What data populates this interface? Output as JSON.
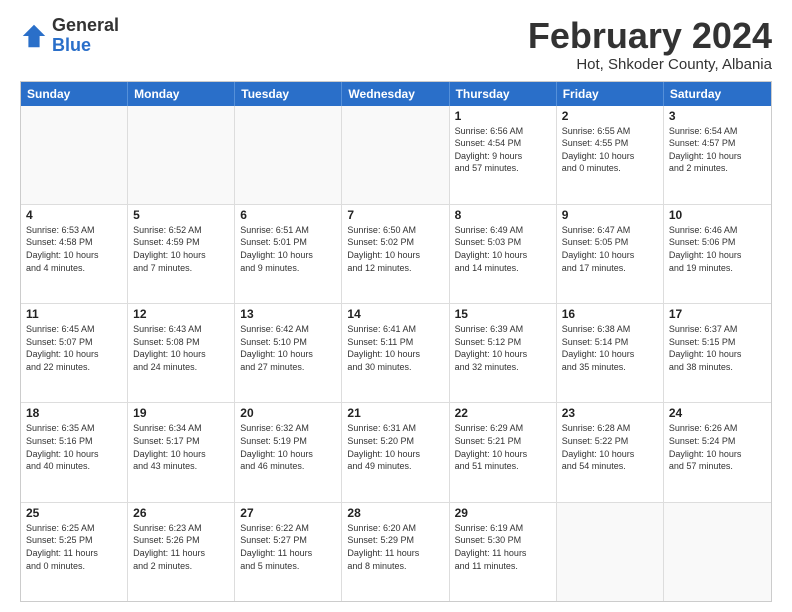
{
  "logo": {
    "general": "General",
    "blue": "Blue"
  },
  "title": {
    "main": "February 2024",
    "sub": "Hot, Shkoder County, Albania"
  },
  "calendar": {
    "headers": [
      "Sunday",
      "Monday",
      "Tuesday",
      "Wednesday",
      "Thursday",
      "Friday",
      "Saturday"
    ],
    "rows": [
      [
        {
          "day": "",
          "info": "",
          "empty": true
        },
        {
          "day": "",
          "info": "",
          "empty": true
        },
        {
          "day": "",
          "info": "",
          "empty": true
        },
        {
          "day": "",
          "info": "",
          "empty": true
        },
        {
          "day": "1",
          "info": "Sunrise: 6:56 AM\nSunset: 4:54 PM\nDaylight: 9 hours\nand 57 minutes."
        },
        {
          "day": "2",
          "info": "Sunrise: 6:55 AM\nSunset: 4:55 PM\nDaylight: 10 hours\nand 0 minutes."
        },
        {
          "day": "3",
          "info": "Sunrise: 6:54 AM\nSunset: 4:57 PM\nDaylight: 10 hours\nand 2 minutes."
        }
      ],
      [
        {
          "day": "4",
          "info": "Sunrise: 6:53 AM\nSunset: 4:58 PM\nDaylight: 10 hours\nand 4 minutes."
        },
        {
          "day": "5",
          "info": "Sunrise: 6:52 AM\nSunset: 4:59 PM\nDaylight: 10 hours\nand 7 minutes."
        },
        {
          "day": "6",
          "info": "Sunrise: 6:51 AM\nSunset: 5:01 PM\nDaylight: 10 hours\nand 9 minutes."
        },
        {
          "day": "7",
          "info": "Sunrise: 6:50 AM\nSunset: 5:02 PM\nDaylight: 10 hours\nand 12 minutes."
        },
        {
          "day": "8",
          "info": "Sunrise: 6:49 AM\nSunset: 5:03 PM\nDaylight: 10 hours\nand 14 minutes."
        },
        {
          "day": "9",
          "info": "Sunrise: 6:47 AM\nSunset: 5:05 PM\nDaylight: 10 hours\nand 17 minutes."
        },
        {
          "day": "10",
          "info": "Sunrise: 6:46 AM\nSunset: 5:06 PM\nDaylight: 10 hours\nand 19 minutes."
        }
      ],
      [
        {
          "day": "11",
          "info": "Sunrise: 6:45 AM\nSunset: 5:07 PM\nDaylight: 10 hours\nand 22 minutes."
        },
        {
          "day": "12",
          "info": "Sunrise: 6:43 AM\nSunset: 5:08 PM\nDaylight: 10 hours\nand 24 minutes."
        },
        {
          "day": "13",
          "info": "Sunrise: 6:42 AM\nSunset: 5:10 PM\nDaylight: 10 hours\nand 27 minutes."
        },
        {
          "day": "14",
          "info": "Sunrise: 6:41 AM\nSunset: 5:11 PM\nDaylight: 10 hours\nand 30 minutes."
        },
        {
          "day": "15",
          "info": "Sunrise: 6:39 AM\nSunset: 5:12 PM\nDaylight: 10 hours\nand 32 minutes."
        },
        {
          "day": "16",
          "info": "Sunrise: 6:38 AM\nSunset: 5:14 PM\nDaylight: 10 hours\nand 35 minutes."
        },
        {
          "day": "17",
          "info": "Sunrise: 6:37 AM\nSunset: 5:15 PM\nDaylight: 10 hours\nand 38 minutes."
        }
      ],
      [
        {
          "day": "18",
          "info": "Sunrise: 6:35 AM\nSunset: 5:16 PM\nDaylight: 10 hours\nand 40 minutes."
        },
        {
          "day": "19",
          "info": "Sunrise: 6:34 AM\nSunset: 5:17 PM\nDaylight: 10 hours\nand 43 minutes."
        },
        {
          "day": "20",
          "info": "Sunrise: 6:32 AM\nSunset: 5:19 PM\nDaylight: 10 hours\nand 46 minutes."
        },
        {
          "day": "21",
          "info": "Sunrise: 6:31 AM\nSunset: 5:20 PM\nDaylight: 10 hours\nand 49 minutes."
        },
        {
          "day": "22",
          "info": "Sunrise: 6:29 AM\nSunset: 5:21 PM\nDaylight: 10 hours\nand 51 minutes."
        },
        {
          "day": "23",
          "info": "Sunrise: 6:28 AM\nSunset: 5:22 PM\nDaylight: 10 hours\nand 54 minutes."
        },
        {
          "day": "24",
          "info": "Sunrise: 6:26 AM\nSunset: 5:24 PM\nDaylight: 10 hours\nand 57 minutes."
        }
      ],
      [
        {
          "day": "25",
          "info": "Sunrise: 6:25 AM\nSunset: 5:25 PM\nDaylight: 11 hours\nand 0 minutes."
        },
        {
          "day": "26",
          "info": "Sunrise: 6:23 AM\nSunset: 5:26 PM\nDaylight: 11 hours\nand 2 minutes."
        },
        {
          "day": "27",
          "info": "Sunrise: 6:22 AM\nSunset: 5:27 PM\nDaylight: 11 hours\nand 5 minutes."
        },
        {
          "day": "28",
          "info": "Sunrise: 6:20 AM\nSunset: 5:29 PM\nDaylight: 11 hours\nand 8 minutes."
        },
        {
          "day": "29",
          "info": "Sunrise: 6:19 AM\nSunset: 5:30 PM\nDaylight: 11 hours\nand 11 minutes."
        },
        {
          "day": "",
          "info": "",
          "empty": true
        },
        {
          "day": "",
          "info": "",
          "empty": true
        }
      ]
    ]
  }
}
